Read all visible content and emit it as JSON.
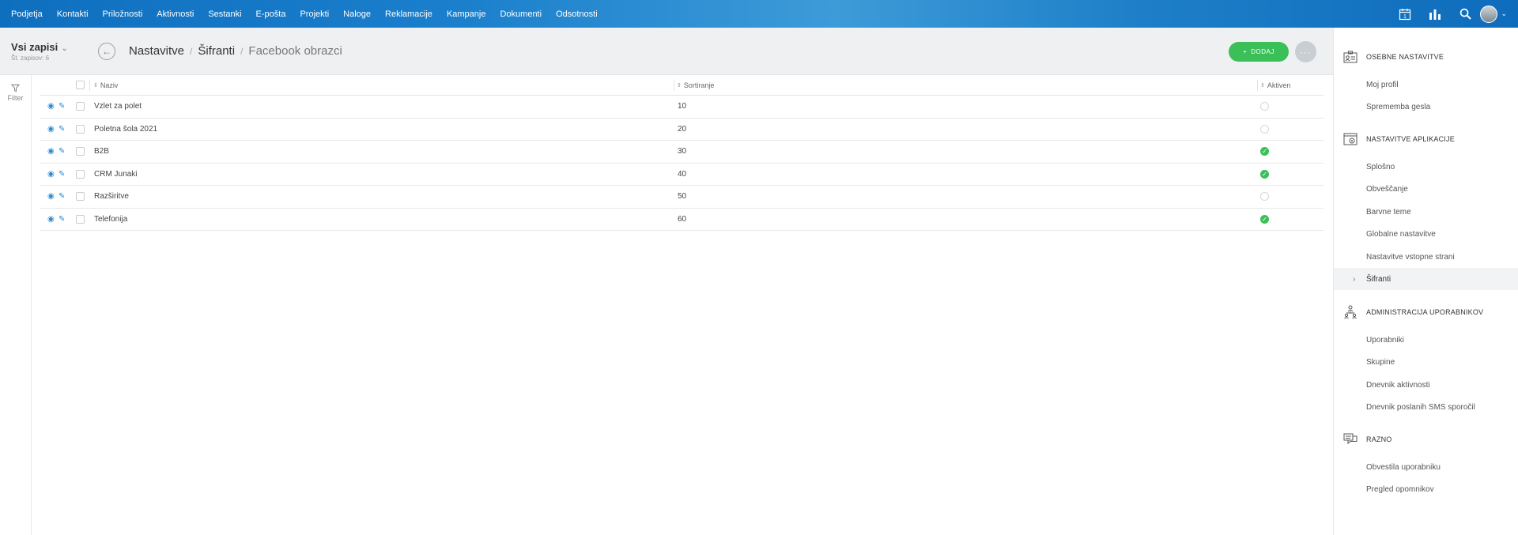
{
  "topnav": {
    "items": [
      "Podjetja",
      "Kontakti",
      "Priložnosti",
      "Aktivnosti",
      "Sestanki",
      "E-pošta",
      "Projekti",
      "Naloge",
      "Reklamacije",
      "Kampanje",
      "Dokumenti",
      "Odsotnosti"
    ],
    "calendar_day": "1"
  },
  "header": {
    "view_title": "Vsi zapisi",
    "record_count": "Št. zapisov: 6",
    "breadcrumb": [
      "Nastavitve",
      "Šifranti",
      "Facebook obrazci"
    ],
    "add_label": "DODAJ",
    "more_label": "···"
  },
  "filter": {
    "label": "Filter"
  },
  "table": {
    "columns": [
      "Naziv",
      "Sortiranje",
      "Aktiven"
    ],
    "rows": [
      {
        "name": "Vzlet za polet",
        "sort": "10",
        "active": false
      },
      {
        "name": "Poletna šola 2021",
        "sort": "20",
        "active": false
      },
      {
        "name": "B2B",
        "sort": "30",
        "active": true
      },
      {
        "name": "CRM Junaki",
        "sort": "40",
        "active": true
      },
      {
        "name": "Razširitve",
        "sort": "50",
        "active": false
      },
      {
        "name": "Telefonija",
        "sort": "60",
        "active": true
      }
    ]
  },
  "sidebar": {
    "sections": [
      {
        "title": "OSEBNE NASTAVITVE",
        "icon": "id-card-icon",
        "items": [
          "Moj profil",
          "Sprememba gesla"
        ]
      },
      {
        "title": "NASTAVITVE APLIKACIJE",
        "icon": "app-settings-icon",
        "items": [
          "Splošno",
          "Obveščanje",
          "Barvne teme",
          "Globalne nastavitve",
          "Nastavitve vstopne strani",
          "Šifranti"
        ]
      },
      {
        "title": "ADMINISTRACIJA UPORABNIKOV",
        "icon": "users-admin-icon",
        "items": [
          "Uporabniki",
          "Skupine",
          "Dnevnik aktivnosti",
          "Dnevnik poslanih SMS sporočil"
        ]
      },
      {
        "title": "RAZNO",
        "icon": "chat-icon",
        "items": [
          "Obvestila uporabniku",
          "Pregled opomnikov"
        ]
      }
    ],
    "active_item": "Šifranti"
  },
  "colors": {
    "nav": "#1a7fcc",
    "accent_green": "#3bbf58",
    "link_blue": "#2b8ad1"
  }
}
